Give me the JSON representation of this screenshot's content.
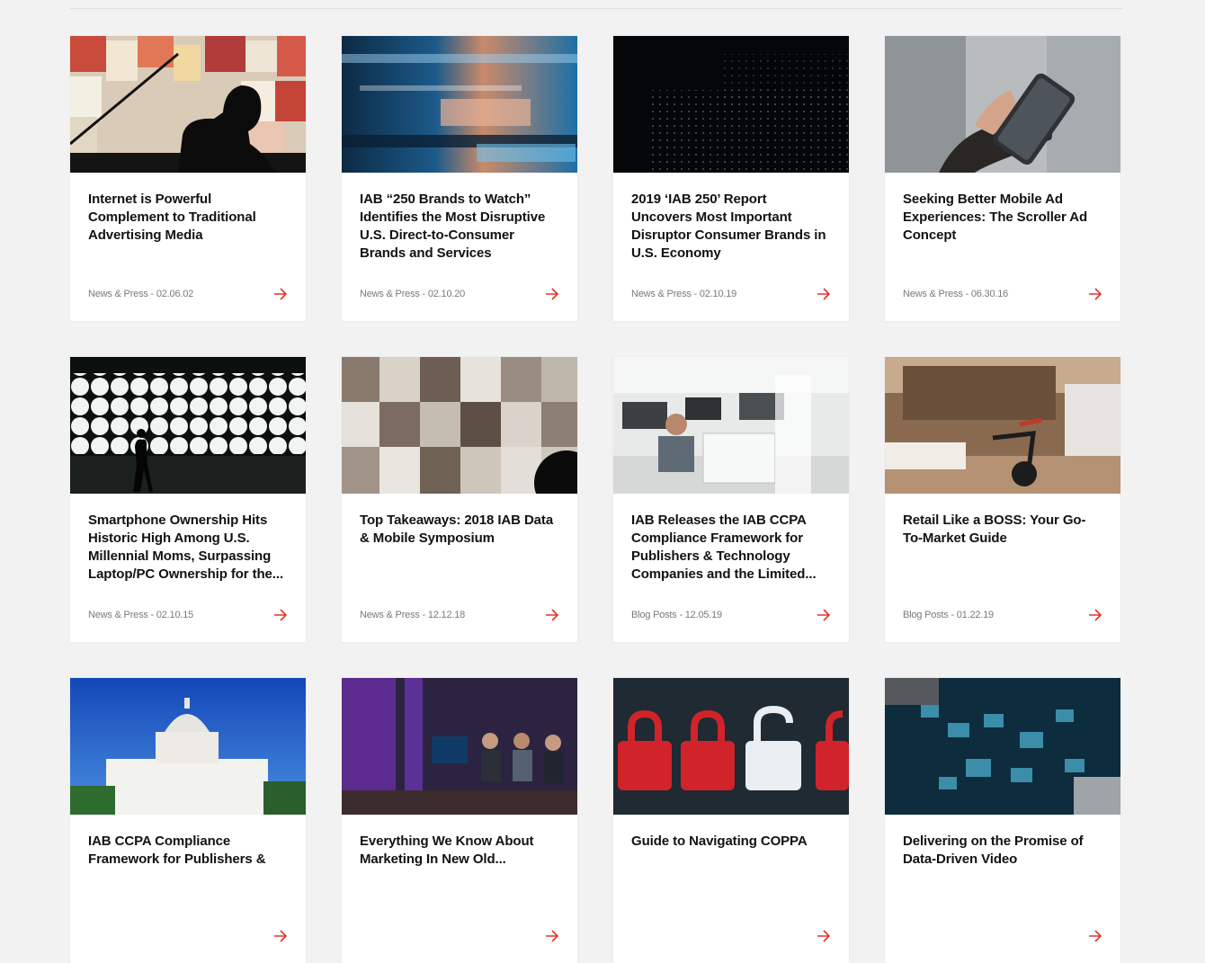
{
  "cards": [
    {
      "title": "Internet is Powerful Complement to Traditional Advertising Media",
      "category": "News & Press",
      "date": "02.06.02",
      "image_icon": "silhouette-posters-image"
    },
    {
      "title": "IAB “250 Brands to Watch” Identifies the Most Disruptive U.S. Direct-to-Consumer Brands and Services",
      "category": "News & Press",
      "date": "02.10.20",
      "image_icon": "motion-blur-image"
    },
    {
      "title": "2019 ‘IAB 250’ Report Uncovers Most Important Disruptor Consumer Brands in U.S. Economy",
      "category": "News & Press",
      "date": "02.10.19",
      "image_icon": "dark-dots-image"
    },
    {
      "title": "Seeking Better Mobile Ad Experiences: The Scroller Ad Concept",
      "category": "News & Press",
      "date": "06.30.16",
      "image_icon": "hand-phone-image"
    },
    {
      "title": "Smartphone Ownership Hits Historic High Among U.S. Millennial Moms, Surpassing Laptop/PC Ownership for the...",
      "category": "News & Press",
      "date": "02.10.15",
      "image_icon": "lights-walker-image"
    },
    {
      "title": "Top Takeaways: 2018 IAB Data & Mobile Symposium",
      "category": "News & Press",
      "date": "12.12.18",
      "image_icon": "collage-image"
    },
    {
      "title": "IAB Releases the IAB CCPA Compliance Framework for Publishers & Technology Companies and the Limited...",
      "category": "Blog Posts",
      "date": "12.05.19",
      "image_icon": "office-image"
    },
    {
      "title": "Retail Like a BOSS: Your Go-To-Market Guide",
      "category": "Blog Posts",
      "date": "01.22.19",
      "image_icon": "store-bike-image"
    },
    {
      "title": "IAB CCPA Compliance Framework for Publishers &",
      "category": "",
      "date": "",
      "image_icon": "capitol-image"
    },
    {
      "title": "Everything We Know About Marketing In New Old...",
      "category": "",
      "date": "",
      "image_icon": "stage-panel-image"
    },
    {
      "title": "Guide to Navigating COPPA",
      "category": "",
      "date": "",
      "image_icon": "padlocks-image"
    },
    {
      "title": "Delivering on the Promise of Data-Driven Video",
      "category": "",
      "date": "",
      "image_icon": "data-screens-image"
    }
  ],
  "accent_color": "#e4352b"
}
